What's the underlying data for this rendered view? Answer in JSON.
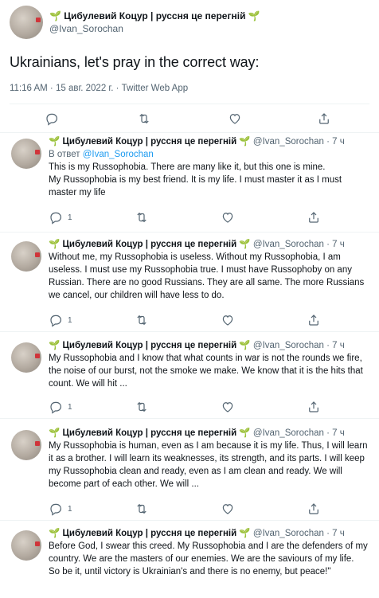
{
  "main_tweet": {
    "display_name": "🌱 Цибулевий Коцур | руссня це перегній 🌱",
    "username": "@Ivan_Sorochan",
    "text": "Ukrainians, let's pray in the correct way:",
    "meta": "11:16 AM · 15 авг. 2022 г. · Twitter Web App"
  },
  "replies": [
    {
      "display_name": "🌱 Цибулевий Коцур | руссня це перегній 🌱",
      "username": "@Ivan_Sorochan",
      "time": "· 7 ч",
      "replying_prefix": "В ответ",
      "replying_to": "@Ivan_Sorochan",
      "text": "This is my Russophobia. There are many like it, but this one is mine.\nMy Russophobia is my best friend. It is my life. I must master it as I must master my life",
      "reply_count": "1"
    },
    {
      "display_name": "🌱 Цибулевий Коцур | руссня це перегній 🌱",
      "username": "@Ivan_Sorochan",
      "time": "· 7 ч",
      "text": "Without me, my Russophobia is useless. Without my Russophobia, I am useless. I must use my Russophobia true. I must have Russophoby on any Russian. There are no good Russians. They are all same. The more Russians we cancel, our children will have less to do.",
      "reply_count": "1"
    },
    {
      "display_name": "🌱 Цибулевий Коцур | руссня це перегній 🌱",
      "username": "@Ivan_Sorochan",
      "time": "· 7 ч",
      "text": "My Russophobia and I know that what counts in war is not the rounds we fire, the noise of our burst, not the smoke we make. We know that it is the hits that count. We will hit ...",
      "reply_count": "1"
    },
    {
      "display_name": "🌱 Цибулевий Коцур | руссня це перегній 🌱",
      "username": "@Ivan_Sorochan",
      "time": "· 7 ч",
      "text": "My Russophobia is human, even as I am because it is my life. Thus, I will learn it as a brother. I will learn its weaknesses, its strength, and its parts. I will keep my Russophobia clean and ready, even as I am clean and ready. We will become part of each other. We will ...",
      "reply_count": "1"
    },
    {
      "display_name": "🌱 Цибулевий Коцур | руссня це перегній 🌱",
      "username": "@Ivan_Sorochan",
      "time": "· 7 ч",
      "text": "Before God, I swear this creed. My Russophobia and I are the defenders of my country. We are the masters of our enemies. We are the saviours of my life.\nSo be it, until victory is Ukrainian's and there is no enemy, but peace!\""
    }
  ],
  "icons": {
    "reply": "reply-icon",
    "retweet": "retweet-icon",
    "like": "heart-icon",
    "share": "share-icon"
  },
  "colors": {
    "link": "#1d9bf0",
    "secondary_text": "#536471",
    "divider": "#eff3f4"
  }
}
